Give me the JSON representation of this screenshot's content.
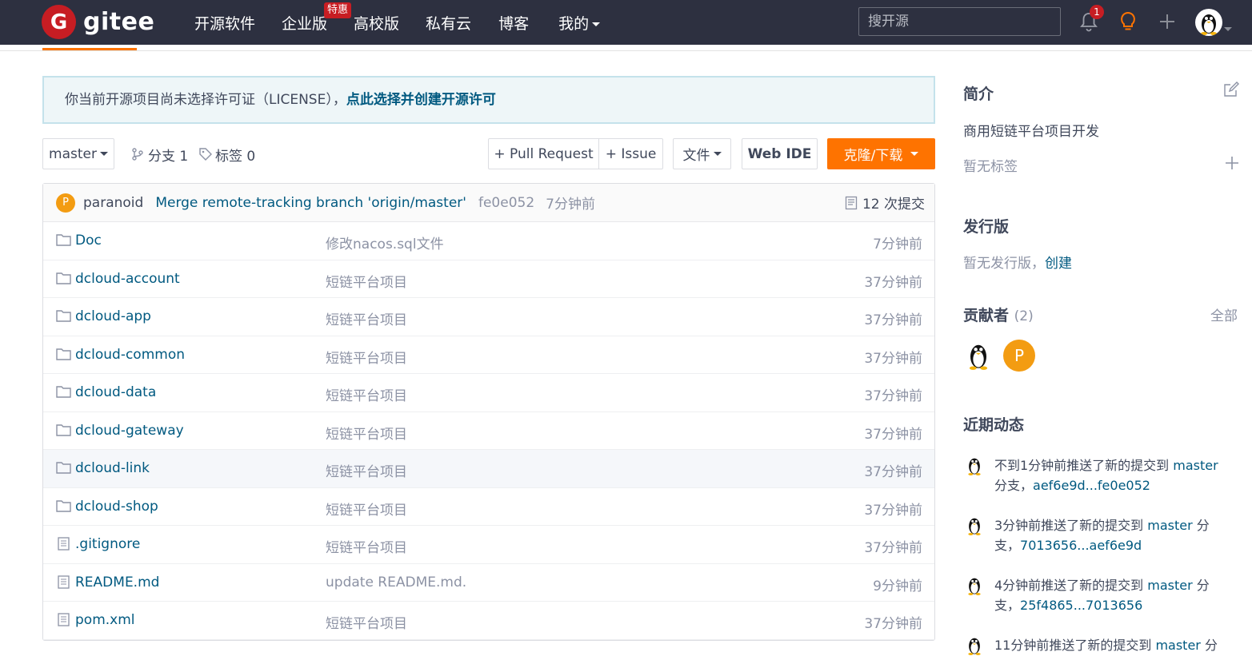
{
  "topbar": {
    "logo_letter": "G",
    "logo_text": "gitee",
    "nav": [
      "开源软件",
      "企业版",
      "高校版",
      "私有云",
      "博客",
      "我的"
    ],
    "promo_badge": "特惠",
    "search_placeholder": "搜开源",
    "notification_count": "1"
  },
  "notice": {
    "text": "你当前开源项目尚未选择许可证（LICENSE），",
    "link": "点此选择并创建开源许可"
  },
  "toolbar": {
    "branch_select": "master",
    "branches_label": "分支 1",
    "tags_label": "标签 0",
    "pull_request": "+ Pull Request",
    "issue": "+ Issue",
    "file_menu": "文件",
    "web_ide": "Web IDE",
    "clone": "克隆/下载"
  },
  "commit": {
    "avatar_letter": "P",
    "author": "paranoid",
    "message": "Merge remote-tracking branch 'origin/master'",
    "hash": "fe0e052",
    "time": "7分钟前",
    "count_label": "12 次提交"
  },
  "files": [
    {
      "type": "folder",
      "name": "Doc",
      "message": "修改nacos.sql文件",
      "time": "7分钟前"
    },
    {
      "type": "folder",
      "name": "dcloud-account",
      "message": "短链平台项目",
      "time": "37分钟前"
    },
    {
      "type": "folder",
      "name": "dcloud-app",
      "message": "短链平台项目",
      "time": "37分钟前"
    },
    {
      "type": "folder",
      "name": "dcloud-common",
      "message": "短链平台项目",
      "time": "37分钟前"
    },
    {
      "type": "folder",
      "name": "dcloud-data",
      "message": "短链平台项目",
      "time": "37分钟前"
    },
    {
      "type": "folder",
      "name": "dcloud-gateway",
      "message": "短链平台项目",
      "time": "37分钟前"
    },
    {
      "type": "folder",
      "name": "dcloud-link",
      "message": "短链平台项目",
      "time": "37分钟前"
    },
    {
      "type": "folder",
      "name": "dcloud-shop",
      "message": "短链平台项目",
      "time": "37分钟前"
    },
    {
      "type": "file",
      "name": ".gitignore",
      "message": "短链平台项目",
      "time": "37分钟前"
    },
    {
      "type": "file",
      "name": "README.md",
      "message": "update README.md.",
      "time": "9分钟前"
    },
    {
      "type": "file",
      "name": "pom.xml",
      "message": "短链平台项目",
      "time": "37分钟前"
    }
  ],
  "sidebar": {
    "intro_title": "简介",
    "intro_text": "商用短链平台项目开发",
    "no_tags": "暂无标签",
    "release_title": "发行版",
    "no_release": "暂无发行版，",
    "create": "创建",
    "contributors_title": "贡献者",
    "contributors_count": "(2)",
    "all": "全部",
    "contributor_letter": "P",
    "activity_title": "近期动态",
    "activities": [
      {
        "text": "不到1分钟前推送了新的提交到 ",
        "branch": "master",
        "line2_prefix": "分支，",
        "range": "aef6e9d...fe0e052"
      },
      {
        "text": "3分钟前推送了新的提交到 ",
        "branch": "master",
        "line1_suffix": " 分",
        "line2_prefix": "支，",
        "range": "7013656...aef6e9d"
      },
      {
        "text": "4分钟前推送了新的提交到 ",
        "branch": "master",
        "line1_suffix": " 分",
        "line2_prefix": "支，",
        "range": "25f4865...7013656"
      },
      {
        "text": "11分钟前推送了新的提交到 ",
        "branch": "master",
        "line1_suffix": " 分"
      }
    ]
  },
  "colors": {
    "topbar": "#2d3040",
    "brand_red": "#c71d23",
    "accent_orange": "#fe7300",
    "link": "#005980"
  }
}
